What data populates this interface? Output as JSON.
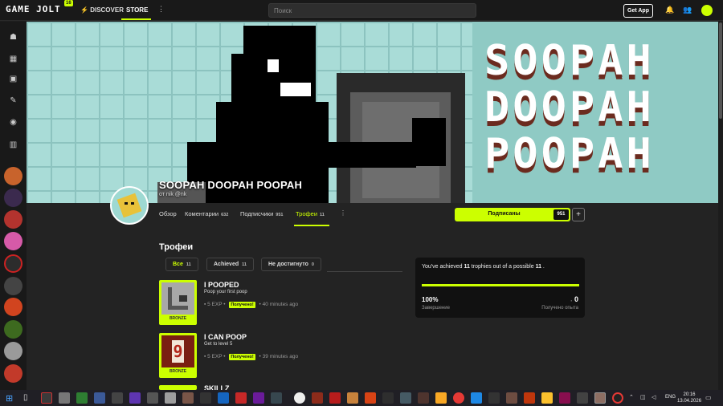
{
  "topbar": {
    "logo": "GAME JOLT",
    "logo_badge": "16",
    "discover": "DISCOVER",
    "store": "STORE",
    "search_placeholder": "Поиск",
    "get_app": "Get App"
  },
  "banner": {
    "art_text": [
      "SOOPAH",
      "DOOPAH",
      "POOPAH"
    ]
  },
  "game": {
    "title": "SOOPAH DOOPAH POOPAH",
    "author": "от nik @nk"
  },
  "tabs": [
    {
      "label": "Обзор",
      "count": ""
    },
    {
      "label": "Коментарии",
      "count": "632"
    },
    {
      "label": "Подписчики",
      "count": "951"
    },
    {
      "label": "Трофеи",
      "count": "11"
    }
  ],
  "follow": {
    "label": "Подписаны",
    "count": "951"
  },
  "trophies": {
    "section_title": "Трофеи",
    "filters": [
      {
        "label": "Все",
        "count": "11"
      },
      {
        "label": "Achieved",
        "count": "11"
      },
      {
        "label": "Не достигнуто",
        "count": "0"
      }
    ],
    "items": [
      {
        "title": "I POOPED",
        "desc": "Poop your first poop",
        "exp": "5 EXP",
        "status": "Получено!",
        "time": "40 minutes ago",
        "rank": "BRONZE"
      },
      {
        "title": "I CAN POOP",
        "desc": "Get to level 5",
        "exp": "5 EXP",
        "status": "Получено!",
        "time": "39 minutes ago",
        "rank": "BRONZE"
      },
      {
        "title": "SKILLZ",
        "desc": "",
        "exp": "",
        "status": "",
        "time": "",
        "rank": ""
      }
    ]
  },
  "progress": {
    "text_prefix": "You've achieved ",
    "achieved": "11",
    "text_mid": " trophies out of a possible ",
    "possible": "11",
    "text_suffix": " .",
    "percent": "100%",
    "percent_label": "Завершение",
    "exp": "0",
    "exp_label": "Получено опыта"
  },
  "taskbar": {
    "time": "20:16",
    "date": "13.04.2026",
    "lang": "ENG"
  },
  "colors": {
    "accent": "#ccff00",
    "bg": "#232323",
    "banner_bg": "#9dcfcb"
  }
}
